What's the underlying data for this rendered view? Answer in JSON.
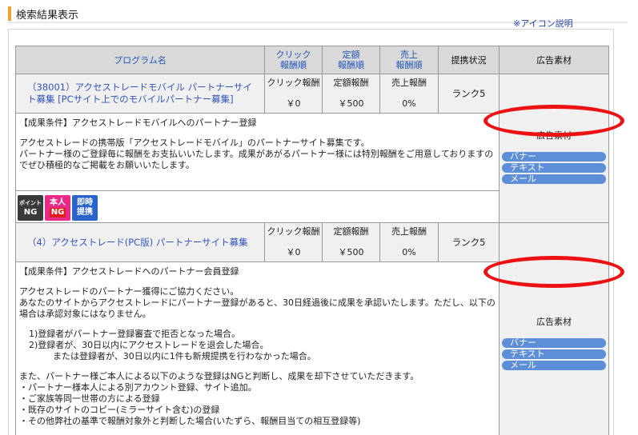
{
  "section_title": "検索結果表示",
  "icon_help_link": "※アイコン説明",
  "table": {
    "headers": {
      "program_name": "プログラム名",
      "click_sort": [
        "クリック",
        "報酬順"
      ],
      "fixed_sort": [
        "定額",
        "報酬順"
      ],
      "sales_sort": [
        "売上",
        "報酬順"
      ],
      "status": "提携状況",
      "material": "広告素材"
    },
    "programs": [
      {
        "name": "（38001）アクセストレードモバイル パートナーサイト募集 [PCサイト上でのモバイルパートナー募集]",
        "click_label": "クリック報酬",
        "click_value": "￥0",
        "fixed_label": "定額報酬",
        "fixed_value": "￥500",
        "sales_label": "売上報酬",
        "sales_value": "0%",
        "rank": "ランク5",
        "material_label": "広告素材",
        "material_buttons": [
          "バナー",
          "テキスト",
          "メール"
        ],
        "description": [
          "【成果条件】アクセストレードモバイルへのパートナー登録",
          "",
          "アクセストレードの携帯版「アクセストレードモバイル」のパートナーサイト募集です。",
          "パートナー様のご登録毎に報酬をお支払いいたします。成果があがるパートナー様には特別報酬をご用意しておりますのでぜひ積極的なご掲載をお願いいたします。"
        ],
        "badges": [
          {
            "top": "ポイント",
            "bottom": "NG",
            "icon": "point-ng-badge"
          },
          {
            "top": "本人",
            "bottom": "NG",
            "icon": "self-ng-badge"
          },
          {
            "top": "即時",
            "bottom": "提携",
            "icon": "instant-partner-badge"
          }
        ]
      },
      {
        "name": "（4）アクセストレード(PC版) パートナーサイト募集",
        "click_label": "クリック報酬",
        "click_value": "￥0",
        "fixed_label": "定額報酬",
        "fixed_value": "￥500",
        "sales_label": "売上報酬",
        "sales_value": "0%",
        "rank": "ランク5",
        "material_label": "広告素材",
        "material_buttons": [
          "バナー",
          "テキスト",
          "メール"
        ],
        "description": [
          "【成果条件】アクセストレードへのパートナー会員登録",
          "",
          "アクセストレードのパートナー獲得にご協力ください。",
          "あなたのサイトからアクセストレードにパートナー登録があると、30日経過後に成果を承認いたします。ただし、以下の場合は承認対象にはなりません。",
          "",
          "1)登録者がパートナー登録審査で拒否となった場合。",
          "2)登録者が、30日以内にアクセストレードを退会した場合。",
          "または登録者が、30日以内に1件も新規提携を行わなかった場合。",
          "",
          "また、パートナー様ご本人による以下のような登録はNGと判断し、成果を却下させていただきます。",
          "・パートナー様本人による別アカウント登録、サイト追加。",
          "・ご家族等同一世帯の方による登録",
          "・既存のサイトのコピー(ミラーサイト含む)の登録",
          "・その他弊社の基準で報酬対象外と判断した場合(いたずら、報酬目当ての相互登録等)"
        ]
      }
    ]
  },
  "colors": {
    "accent_bar": "#f0a030",
    "header_bg": "#d9d9d9",
    "link_blue": "#3355bb",
    "pill_blue": "#5d8fd8",
    "annotation_red": "#ee1111"
  }
}
